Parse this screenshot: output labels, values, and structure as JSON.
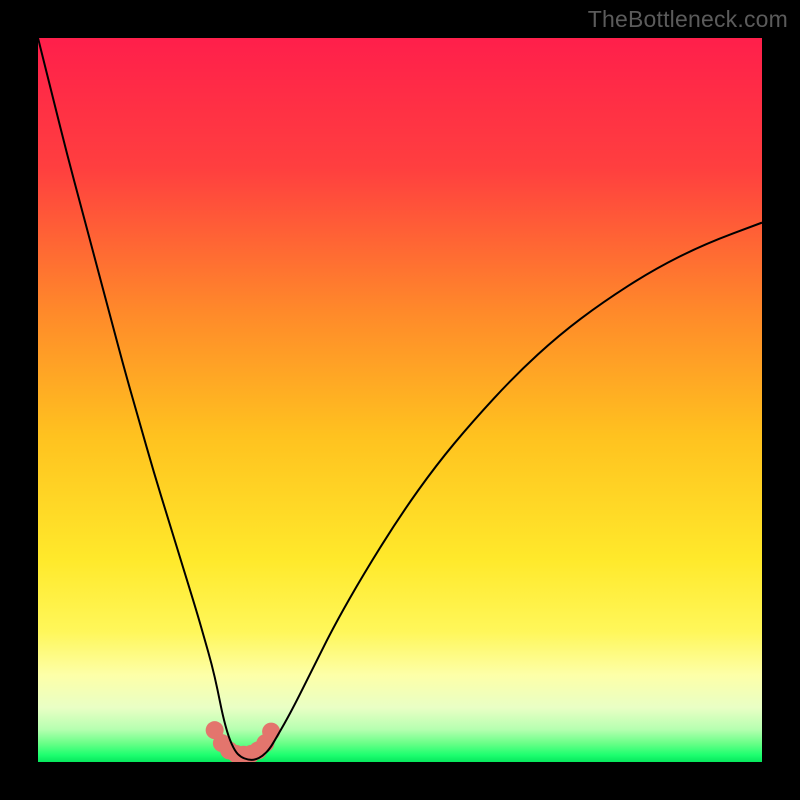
{
  "watermark": "TheBottleneck.com",
  "chart_data": {
    "type": "line",
    "title": "",
    "xlabel": "",
    "ylabel": "",
    "xlim": [
      0,
      100
    ],
    "ylim": [
      0,
      100
    ],
    "grid": false,
    "legend": false,
    "gradient_stops": [
      {
        "offset": 0.0,
        "color": "#ff1f4b"
      },
      {
        "offset": 0.18,
        "color": "#ff3f3f"
      },
      {
        "offset": 0.38,
        "color": "#ff8a2a"
      },
      {
        "offset": 0.55,
        "color": "#ffc21f"
      },
      {
        "offset": 0.72,
        "color": "#ffe92b"
      },
      {
        "offset": 0.82,
        "color": "#fff75a"
      },
      {
        "offset": 0.88,
        "color": "#fdffa8"
      },
      {
        "offset": 0.925,
        "color": "#e9ffc5"
      },
      {
        "offset": 0.955,
        "color": "#b6ffb0"
      },
      {
        "offset": 0.975,
        "color": "#66ff86"
      },
      {
        "offset": 0.99,
        "color": "#1fff70"
      },
      {
        "offset": 1.0,
        "color": "#06e85d"
      }
    ],
    "series": [
      {
        "name": "bottleneck-curve",
        "color": "#000000",
        "width": 2.0,
        "x": [
          0,
          2,
          4,
          6,
          8,
          10,
          12,
          14,
          16,
          18,
          20,
          22,
          23,
          24,
          24.8,
          25.5,
          26.3,
          27.2,
          28,
          29,
          30,
          31,
          32,
          33,
          35,
          38,
          41,
          45,
          50,
          55,
          60,
          66,
          72,
          78,
          85,
          92,
          100
        ],
        "y": [
          100,
          92,
          84,
          76.5,
          69,
          61.5,
          54,
          47,
          40,
          33.5,
          27,
          20.5,
          17,
          13.5,
          10,
          6.5,
          3.5,
          1.5,
          0.7,
          0.3,
          0.3,
          0.8,
          1.8,
          3.5,
          7,
          13,
          19,
          26,
          34,
          41,
          47,
          53.5,
          59,
          63.5,
          68,
          71.5,
          74.5
        ]
      },
      {
        "name": "bottom-marker-band",
        "color": "#e3756d",
        "type": "scatter",
        "marker_radius": 9,
        "x": [
          24.4,
          25.4,
          26.4,
          27.4,
          28.4,
          29.4,
          30.4,
          31.4,
          32.2
        ],
        "y": [
          4.4,
          2.6,
          1.6,
          1.1,
          1.0,
          1.1,
          1.6,
          2.6,
          4.2
        ]
      }
    ]
  }
}
